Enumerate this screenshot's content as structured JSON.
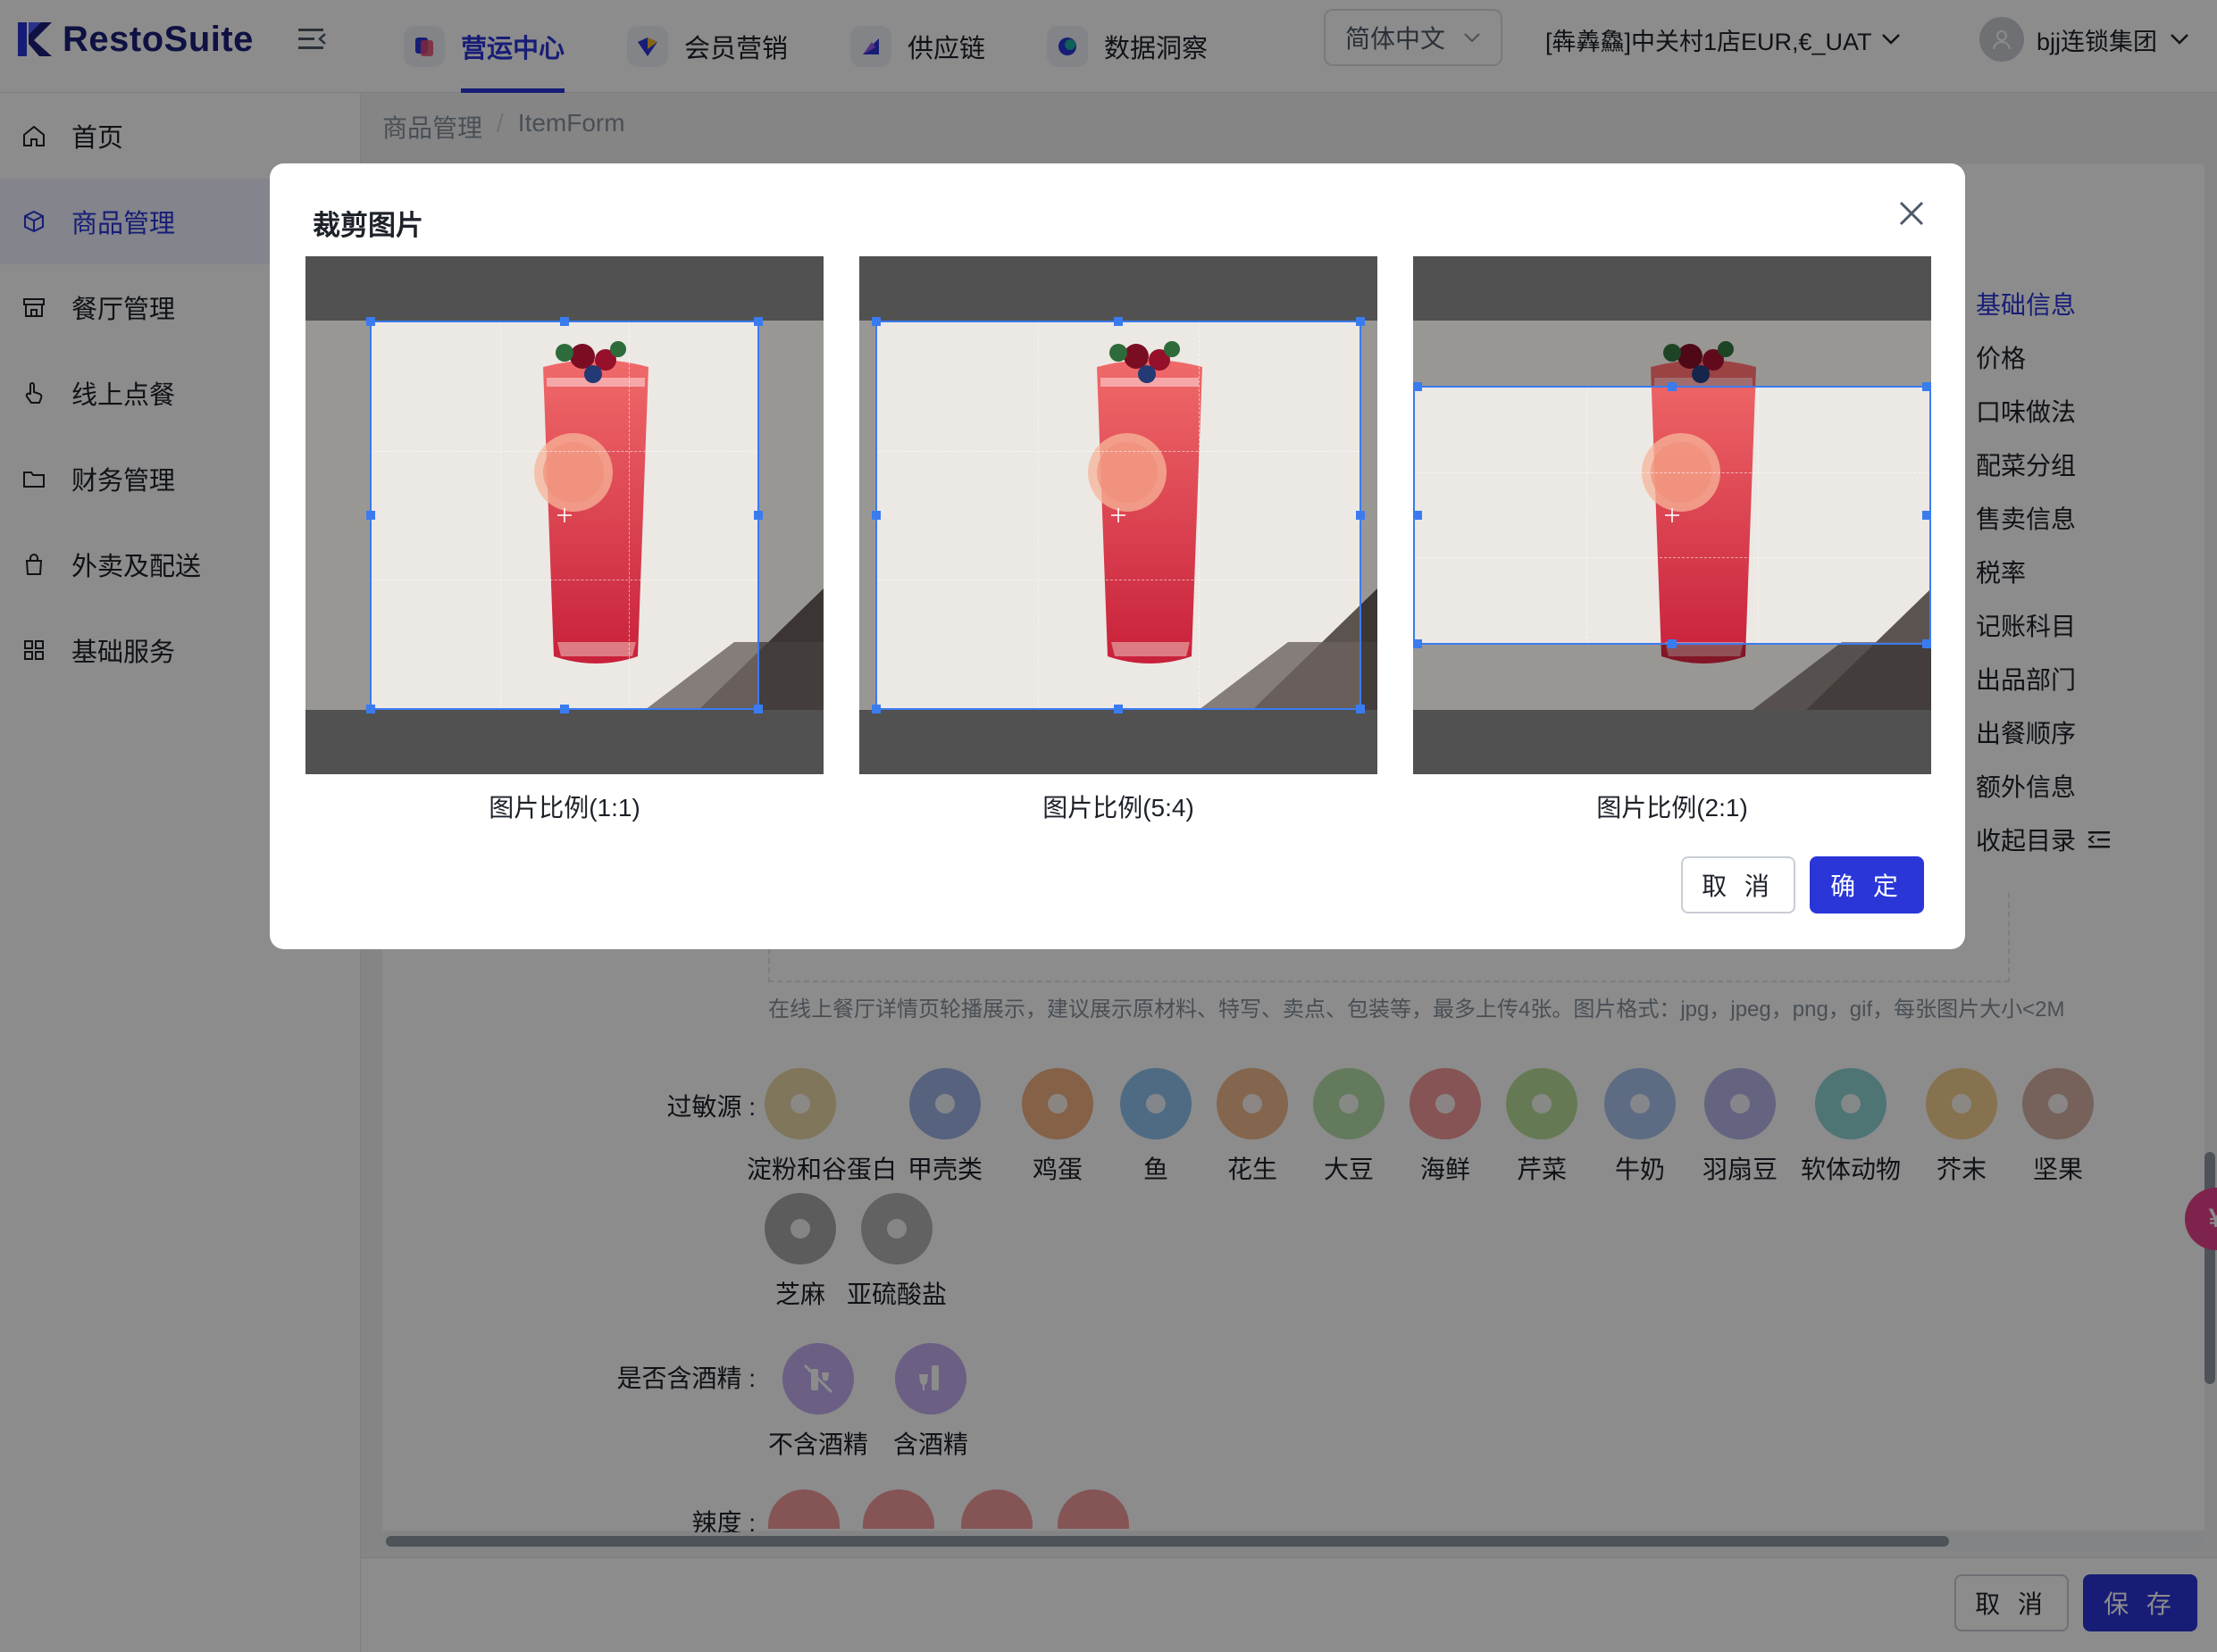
{
  "app": {
    "brand": "RestoSuite",
    "nav_tabs": [
      {
        "label": "营运中心",
        "active": true
      },
      {
        "label": "会员营销",
        "active": false
      },
      {
        "label": "供应链",
        "active": false
      },
      {
        "label": "数据洞察",
        "active": false
      }
    ],
    "language": "简体中文",
    "store": "[犇羴鱻]中关村1店EUR,€_UAT",
    "user": "bjj连锁集团"
  },
  "sidebar": {
    "items": [
      {
        "label": "首页",
        "icon": "home-icon",
        "active": false
      },
      {
        "label": "商品管理",
        "icon": "cube-icon",
        "active": true
      },
      {
        "label": "餐厅管理",
        "icon": "store-icon",
        "active": false
      },
      {
        "label": "线上点餐",
        "icon": "hand-pointer-icon",
        "active": false
      },
      {
        "label": "财务管理",
        "icon": "folder-icon",
        "active": false
      },
      {
        "label": "外卖及配送",
        "icon": "bag-icon",
        "active": false
      },
      {
        "label": "基础服务",
        "icon": "grid-icon",
        "active": false
      }
    ]
  },
  "breadcrumb": [
    "商品管理",
    "ItemForm"
  ],
  "anchor_nav": {
    "items": [
      "基础信息",
      "价格",
      "口味做法",
      "配菜分组",
      "售卖信息",
      "税率",
      "记账科目",
      "出品部门",
      "出餐顺序",
      "额外信息"
    ],
    "collapse_label": "收起目录"
  },
  "form": {
    "upload_hint": "在线上餐厅详情页轮播展示，建议展示原材料、特写、卖点、包装等，最多上传4张。图片格式：jpg，jpeg，png，gif，每张图片大小<2M",
    "allergens_label": "过敏源 :",
    "allergens": [
      {
        "label": "淀粉和谷蛋白",
        "color": "#e7d8a6",
        "icon": "wheat-icon"
      },
      {
        "label": "甲壳类",
        "color": "#9fb3e6",
        "icon": "crab-icon"
      },
      {
        "label": "鸡蛋",
        "color": "#f3b184",
        "icon": "egg-icon"
      },
      {
        "label": "鱼",
        "color": "#8fc3ee",
        "icon": "fish-icon"
      },
      {
        "label": "花生",
        "color": "#f1b88c",
        "icon": "peanut-icon"
      },
      {
        "label": "大豆",
        "color": "#b5dfa8",
        "icon": "soybean-icon"
      },
      {
        "label": "海鲜",
        "color": "#f59a9a",
        "icon": "shrimp-icon"
      },
      {
        "label": "芹菜",
        "color": "#b8df99",
        "icon": "celery-icon"
      },
      {
        "label": "牛奶",
        "color": "#a9c3ef",
        "icon": "milk-icon"
      },
      {
        "label": "羽扇豆",
        "color": "#b6b4ea",
        "icon": "lupin-icon"
      },
      {
        "label": "软体动物",
        "color": "#8fd3d3",
        "icon": "shell-icon"
      },
      {
        "label": "芥末",
        "color": "#f5cf8e",
        "icon": "mustard-icon"
      },
      {
        "label": "坚果",
        "color": "#d8b2a6",
        "icon": "nut-icon"
      },
      {
        "label": "芝麻",
        "color": "#a8a8a8",
        "icon": "sesame-icon"
      },
      {
        "label": "亚硫酸盐",
        "color": "#b3b3b3",
        "icon": "sulphite-icon"
      }
    ],
    "alcohol_label": "是否含酒精 :",
    "alcohol_options": [
      {
        "label": "不含酒精",
        "color": "#c3aef0",
        "icon": "no-alcohol-icon"
      },
      {
        "label": "含酒精",
        "color": "#c3aef0",
        "icon": "alcohol-icon"
      }
    ],
    "spicy_label": "辣度 :",
    "spicy_colors": [
      "#f29a9a",
      "#f29a9a",
      "#f29a9a",
      "#f29a9a"
    ]
  },
  "footer": {
    "cancel": "取 消",
    "save": "保 存"
  },
  "float_ball": "¥",
  "crop_modal": {
    "title": "裁剪图片",
    "panels": [
      {
        "caption": "图片比例(1:1)",
        "ratio": "1:1"
      },
      {
        "caption": "图片比例(5:4)",
        "ratio": "5:4"
      },
      {
        "caption": "图片比例(2:1)",
        "ratio": "2:1"
      }
    ],
    "cancel": "取 消",
    "confirm": "确 定",
    "accent": "#3b7bf0"
  },
  "colors": {
    "primary": "#2a36d8",
    "brand_dark": "#1c1f7a"
  }
}
